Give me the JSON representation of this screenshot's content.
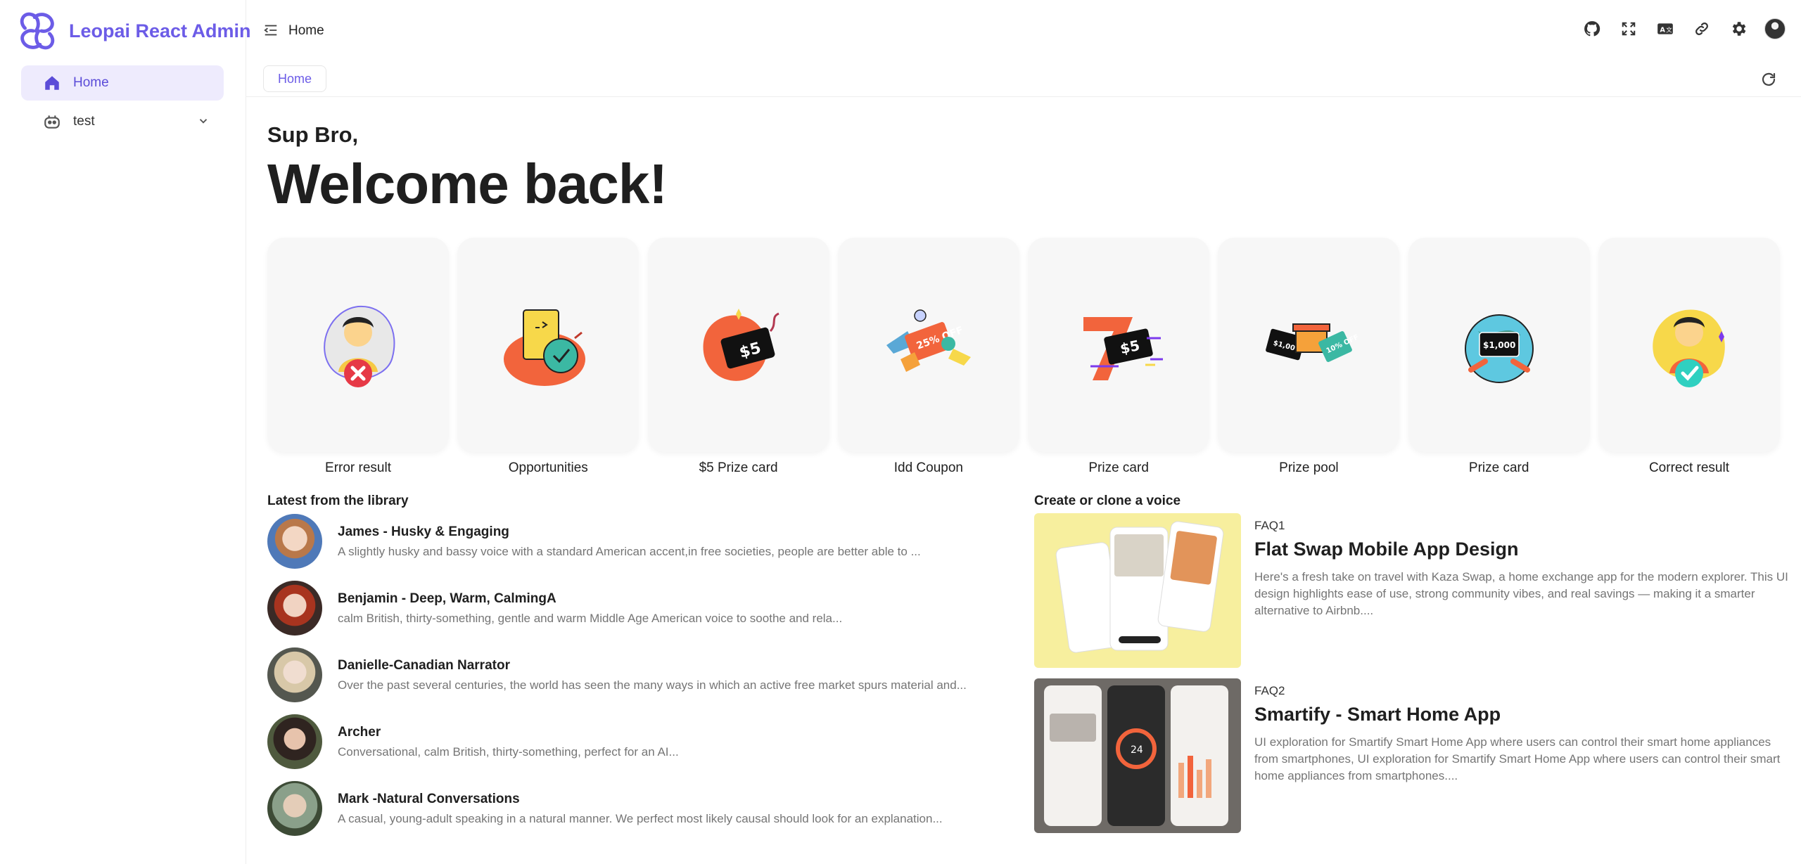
{
  "app": {
    "brand": "Leopai React Admin",
    "brand_color": "#6c5ce7"
  },
  "sidebar": {
    "items": [
      {
        "label": "Home",
        "icon": "home-icon",
        "active": true
      },
      {
        "label": "test",
        "icon": "bot-icon",
        "active": false,
        "expandable": true
      }
    ]
  },
  "header": {
    "title": "Home",
    "icons": [
      "github-icon",
      "fullscreen-icon",
      "language-icon",
      "link-icon",
      "settings-icon",
      "avatar"
    ]
  },
  "tabs": [
    {
      "label": "Home",
      "active": true
    }
  ],
  "main": {
    "greeting": "Sup Bro,",
    "headline": "Welcome back!",
    "cards": [
      {
        "label": "Error result",
        "icon": "error-result-illustration"
      },
      {
        "label": "Opportunities",
        "icon": "opportunities-illustration"
      },
      {
        "label": "$5 Prize card",
        "icon": "prize-card-illustration"
      },
      {
        "label": "Idd Coupon",
        "icon": "coupon-illustration"
      },
      {
        "label": "Prize card",
        "icon": "prize-card-7-illustration"
      },
      {
        "label": "Prize pool",
        "icon": "prize-pool-illustration"
      },
      {
        "label": "Prize card",
        "icon": "prize-card-globe-illustration"
      },
      {
        "label": "Correct result",
        "icon": "correct-result-illustration"
      }
    ]
  },
  "library": {
    "title": "Latest from the library",
    "items": [
      {
        "name": "James - Husky & Engaging",
        "description": "A slightly husky and bassy voice with a standard American accent,in free societies, people are better able to ..."
      },
      {
        "name": "Benjamin - Deep, Warm, CalmingA",
        "description": "calm British, thirty-something, gentle and warm Middle Age American voice to soothe and rela..."
      },
      {
        "name": "Danielle-Canadian Narrator",
        "description": "Over the past several centuries, the world has seen the many ways in which an active free market spurs material and..."
      },
      {
        "name": "Archer",
        "description": "Conversational, calm British, thirty-something, perfect for an AI..."
      },
      {
        "name": "Mark -Natural Conversations",
        "description": "A casual, young-adult speaking in a natural manner. We perfect most likely causal should look for an explanation..."
      }
    ]
  },
  "voice": {
    "title": "Create or clone a voice",
    "items": [
      {
        "tag": "FAQ1",
        "title": "Flat Swap Mobile App Design",
        "description": "Here's a fresh take on travel with Kaza Swap, a home exchange app for the modern explorer. This UI design highlights ease of use, strong community vibes, and real savings — making it a smarter alternative to Airbnb...."
      },
      {
        "tag": "FAQ2",
        "title": "Smartify - Smart Home App",
        "description": "UI exploration for Smartify Smart Home App where users can control their smart home appliances from smartphones, UI exploration for Smartify Smart Home App where users can control their smart home appliances from smartphones...."
      }
    ]
  }
}
